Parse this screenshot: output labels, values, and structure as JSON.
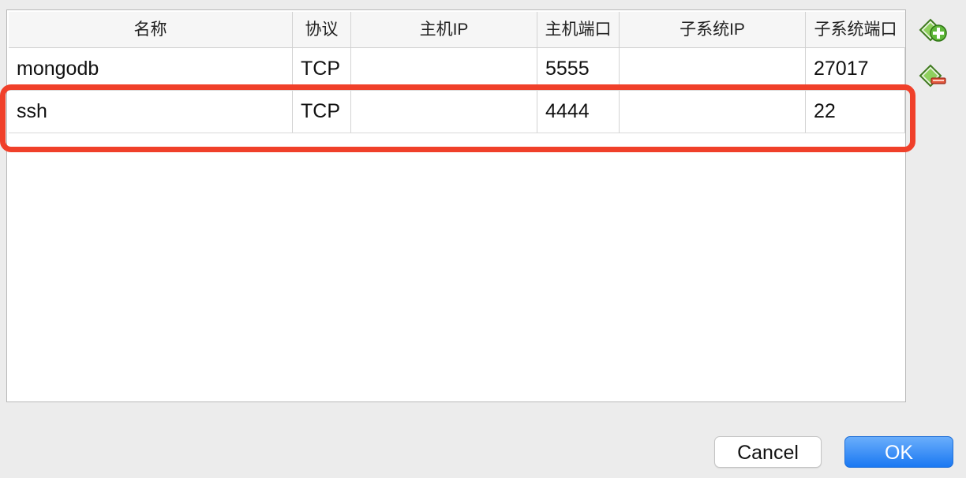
{
  "table": {
    "columns": [
      "名称",
      "协议",
      "主机IP",
      "主机端口",
      "子系统IP",
      "子系统端口"
    ],
    "rows": [
      [
        "mongodb",
        "TCP",
        "",
        "5555",
        "",
        "27017"
      ],
      [
        "ssh",
        "TCP",
        "",
        "4444",
        "",
        "22"
      ]
    ]
  },
  "side_buttons": {
    "add_icon": "add-rule-icon",
    "remove_icon": "remove-rule-icon"
  },
  "buttons": {
    "cancel": "Cancel",
    "ok": "OK"
  },
  "colors": {
    "highlight": "#f0402a",
    "ok_button": "#1a78f2",
    "icon_green": "#5fb83a"
  }
}
